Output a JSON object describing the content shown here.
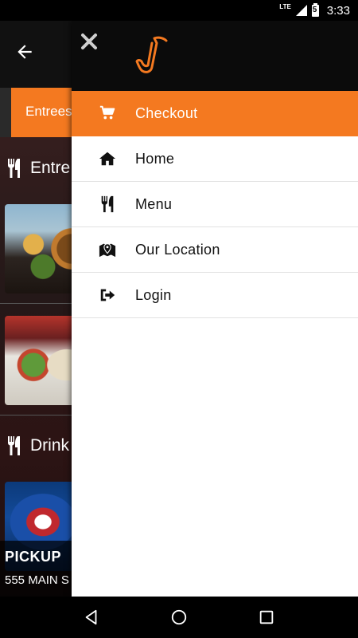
{
  "status_bar": {
    "network": "LTE",
    "battery_level": "5",
    "time": "3:33"
  },
  "background": {
    "tab_label": "Entrees",
    "section_entrees": "Entre",
    "section_drinks": "Drink",
    "pickup_title": "PICKUP",
    "pickup_address": "555 MAIN S"
  },
  "drawer": {
    "menu": [
      {
        "label": "Checkout",
        "icon": "cart-icon",
        "active": true
      },
      {
        "label": "Home",
        "icon": "home-icon",
        "active": false
      },
      {
        "label": "Menu",
        "icon": "fork-knife-icon",
        "active": false
      },
      {
        "label": "Our Location",
        "icon": "map-pin-icon",
        "active": false
      },
      {
        "label": "Login",
        "icon": "sign-in-icon",
        "active": false
      }
    ]
  },
  "colors": {
    "accent": "#f47920",
    "drawer_header": "#0b0b0b",
    "logo_orange": "#f47920"
  }
}
